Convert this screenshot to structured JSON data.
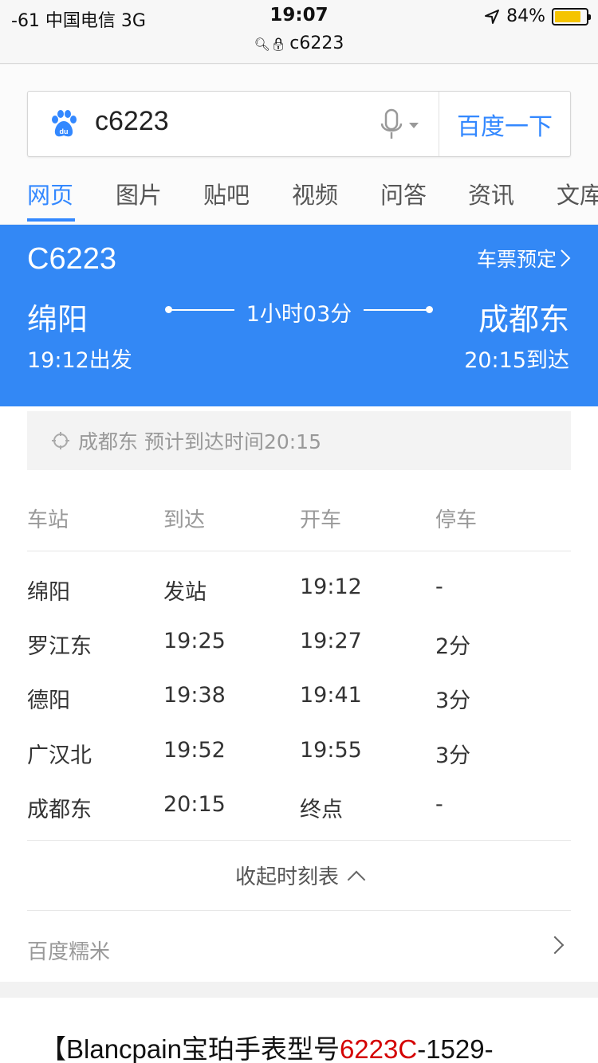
{
  "status_bar": {
    "carrier": "-61 中国电信   3G",
    "time": "19:07",
    "url": "c6223",
    "battery": "84%",
    "battery_level": 0.84,
    "battery_color": "#f5c400"
  },
  "search": {
    "query": "c6223",
    "button_label": "百度一下",
    "logo_icon": "baidu-paw-icon",
    "mic_icon": "microphone-icon"
  },
  "tabs": [
    {
      "label": "网页",
      "active": true
    },
    {
      "label": "图片"
    },
    {
      "label": "贴吧"
    },
    {
      "label": "视频"
    },
    {
      "label": "问答"
    },
    {
      "label": "资讯"
    },
    {
      "label": "文库"
    }
  ],
  "train": {
    "number": "C6223",
    "book_label": "车票预定",
    "from_station": "绵阳",
    "to_station": "成都东",
    "duration": "1小时03分",
    "depart": "19:12出发",
    "arrive": "20:15到达",
    "accent_color": "#3388f5"
  },
  "notice": {
    "text": "成都东 预计到达时间20:15"
  },
  "timetable": {
    "headers": [
      "车站",
      "到达",
      "开车",
      "停车"
    ],
    "rows": [
      [
        "绵阳",
        "发站",
        "19:12",
        "-"
      ],
      [
        "罗江东",
        "19:25",
        "19:27",
        "2分"
      ],
      [
        "德阳",
        "19:38",
        "19:41",
        "3分"
      ],
      [
        "广汉北",
        "19:52",
        "19:55",
        "3分"
      ],
      [
        "成都东",
        "20:15",
        "终点",
        "-"
      ]
    ],
    "collapse_label": "收起时刻表"
  },
  "nuomi": {
    "label": "百度糯米"
  },
  "result": {
    "title_prefix": "【Blancpain宝珀手表型号",
    "title_highlight": "6223C",
    "title_suffix": "-1529-"
  }
}
